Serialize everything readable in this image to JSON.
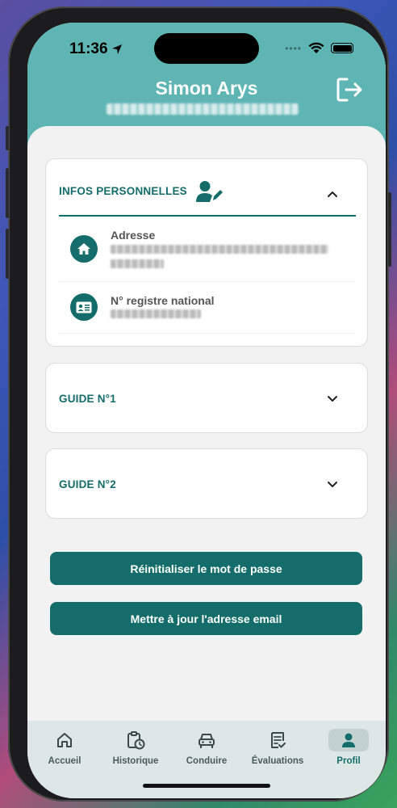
{
  "status_bar": {
    "time": "11:36",
    "signal_dots": "••••"
  },
  "header": {
    "user_name": "Simon Arys"
  },
  "personal_info": {
    "title": "INFOS PERSONNELLES",
    "address_label": "Adresse",
    "registry_label": "N° registre national"
  },
  "guides": [
    {
      "title": "GUIDE N°1"
    },
    {
      "title": "GUIDE N°2"
    }
  ],
  "actions": {
    "reset_password": "Réinitialiser le mot de passe",
    "update_email": "Mettre à jour l'adresse email"
  },
  "tabs": [
    {
      "label": "Accueil",
      "icon": "home-icon"
    },
    {
      "label": "Historique",
      "icon": "history-icon"
    },
    {
      "label": "Conduire",
      "icon": "car-icon"
    },
    {
      "label": "Évaluations",
      "icon": "evaluation-icon"
    },
    {
      "label": "Profil",
      "icon": "profile-icon",
      "active": true
    }
  ],
  "colors": {
    "header": "#5fb5b3",
    "accent": "#146d6a",
    "background": "#f2f2f2"
  }
}
